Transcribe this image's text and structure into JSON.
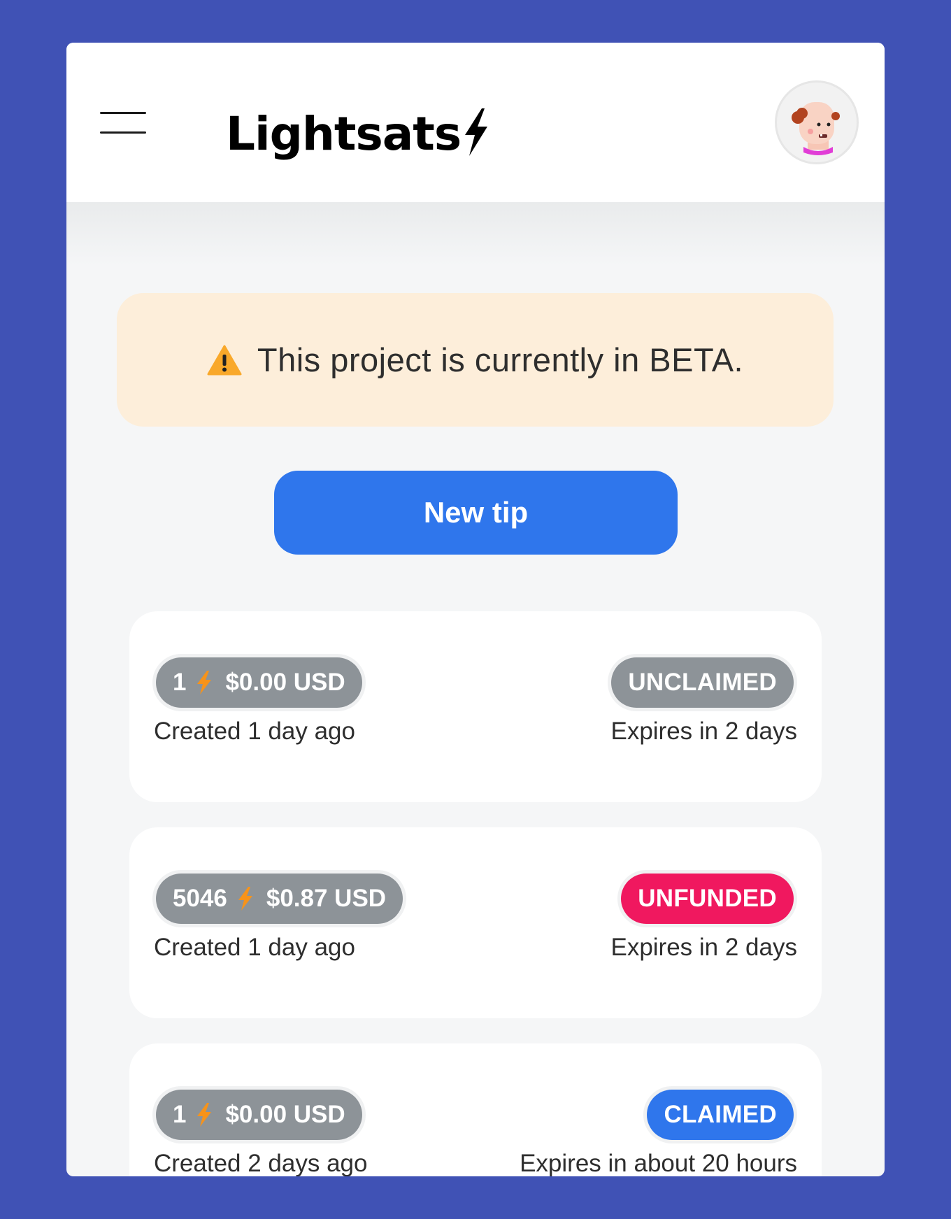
{
  "app": {
    "title": "Lightsats"
  },
  "header": {
    "menu_icon": "hamburger-menu-icon",
    "logo_icon": "lightning-bolt-icon",
    "avatar_icon": "user-avatar-icon"
  },
  "banner": {
    "icon": "warning-icon",
    "text": "This project is currently in BETA."
  },
  "actions": {
    "new_tip_label": "New tip"
  },
  "colors": {
    "background": "#4052B5",
    "primary": "#2F76EC",
    "unfunded": "#F0185F",
    "neutral_pill": "#8D9398",
    "bolt": "#F7931A",
    "banner_bg": "#FDEEDA"
  },
  "tips": [
    {
      "sats": "1",
      "usd": "$0.00 USD",
      "status": "UNCLAIMED",
      "status_color": "#8D9398",
      "created": "Created 1 day ago",
      "expires": "Expires in 2 days"
    },
    {
      "sats": "5046",
      "usd": "$0.87 USD",
      "status": "UNFUNDED",
      "status_color": "#F0185F",
      "created": "Created 1 day ago",
      "expires": "Expires in 2 days"
    },
    {
      "sats": "1",
      "usd": "$0.00 USD",
      "status": "CLAIMED",
      "status_color": "#2F76EC",
      "created": "Created 2 days ago",
      "expires": "Expires in about 20 hours"
    }
  ]
}
